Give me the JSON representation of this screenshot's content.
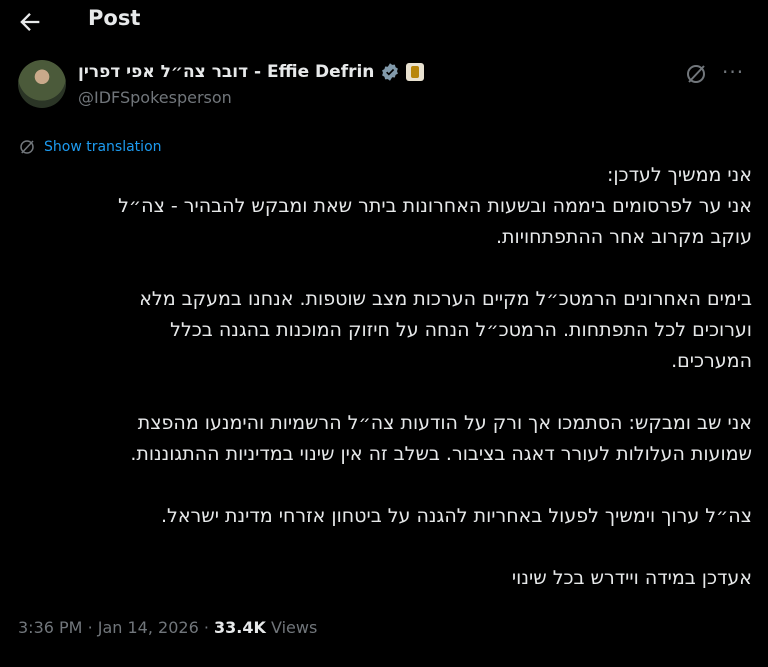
{
  "header": {
    "title": "Post",
    "back_icon": "arrow-left-icon"
  },
  "author": {
    "name": "דובר צה״ל אפי דפרין - Effie Defrin",
    "handle": "@IDFSpokesperson",
    "verified_icon": "verified-badge-icon",
    "affiliation_icon": "affiliation-badge-icon"
  },
  "actions": {
    "grok_icon": "grok-icon",
    "more_label": "···"
  },
  "translation": {
    "label": "Show translation",
    "icon": "translate-icon"
  },
  "post": {
    "lines": [
      "אני ממשיך לעדכן:",
      "אני ער לפרסומים ביממה ובשעות האחרונות ביתר שאת ומבקש להבהיר - צה״ל",
      "עוקב מקרוב אחר ההתפתחויות.",
      "",
      "בימים האחרונים הרמטכ״ל מקיים הערכות מצב שוטפות. אנחנו במעקב מלא",
      "וערוכים לכל התפתחות. הרמטכ״ל הנחה על חיזוק המוכנות בהגנה בכלל",
      "המערכים.",
      "",
      "אני שב ומבקש: הסתמכו אך ורק על הודעות צה״ל הרשמיות והימנעו מהפצת",
      "שמועות העלולות לעורר דאגה בציבור. בשלב זה אין שינוי במדיניות ההתגוננות.",
      "",
      "צה״ל ערוך וימשיך לפעול באחריות להגנה על ביטחון אזרחי מדינת ישראל.",
      "",
      "אעדכן במידה ויידרש בכל שינוי"
    ]
  },
  "meta": {
    "time": "3:36 PM",
    "date": "Jan 14, 2026",
    "views_count": "33.4K",
    "views_label": "Views",
    "separator": "·"
  },
  "colors": {
    "accent": "#1d9bf0",
    "text": "#e7e9ea",
    "muted": "#71767b",
    "bg": "#000000"
  }
}
